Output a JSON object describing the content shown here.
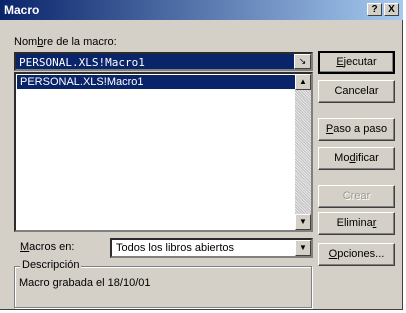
{
  "window": {
    "title": "Macro",
    "help_glyph": "?",
    "close_glyph": "X"
  },
  "macro_name": {
    "label_pre": "Nom",
    "label_accel": "b",
    "label_post": "re de la macro:",
    "value": "PERSONAL.XLS!Macro1",
    "ref_glyph": "↘"
  },
  "macro_list": {
    "items": [
      "PERSONAL.XLS!Macro1"
    ],
    "up_glyph": "▲",
    "down_glyph": "▼"
  },
  "macros_in": {
    "label_accel": "M",
    "label_post": "acros en:",
    "value": "Todos los libros abiertos",
    "dropdown_glyph": "▼"
  },
  "description": {
    "legend": "Descripción",
    "text": "Macro grabada el 18/10/01"
  },
  "buttons": {
    "run": {
      "accel": "E",
      "rest": "jecutar"
    },
    "cancel": {
      "label": "Cancelar"
    },
    "step_into": {
      "accel": "P",
      "rest": "aso a paso"
    },
    "edit_pre": "Mo",
    "edit_accel": "d",
    "edit_post": "ificar",
    "create": {
      "label": "Crear"
    },
    "delete_pre": "Elimina",
    "delete_accel": "r",
    "options": {
      "accel": "O",
      "rest": "pciones..."
    }
  }
}
